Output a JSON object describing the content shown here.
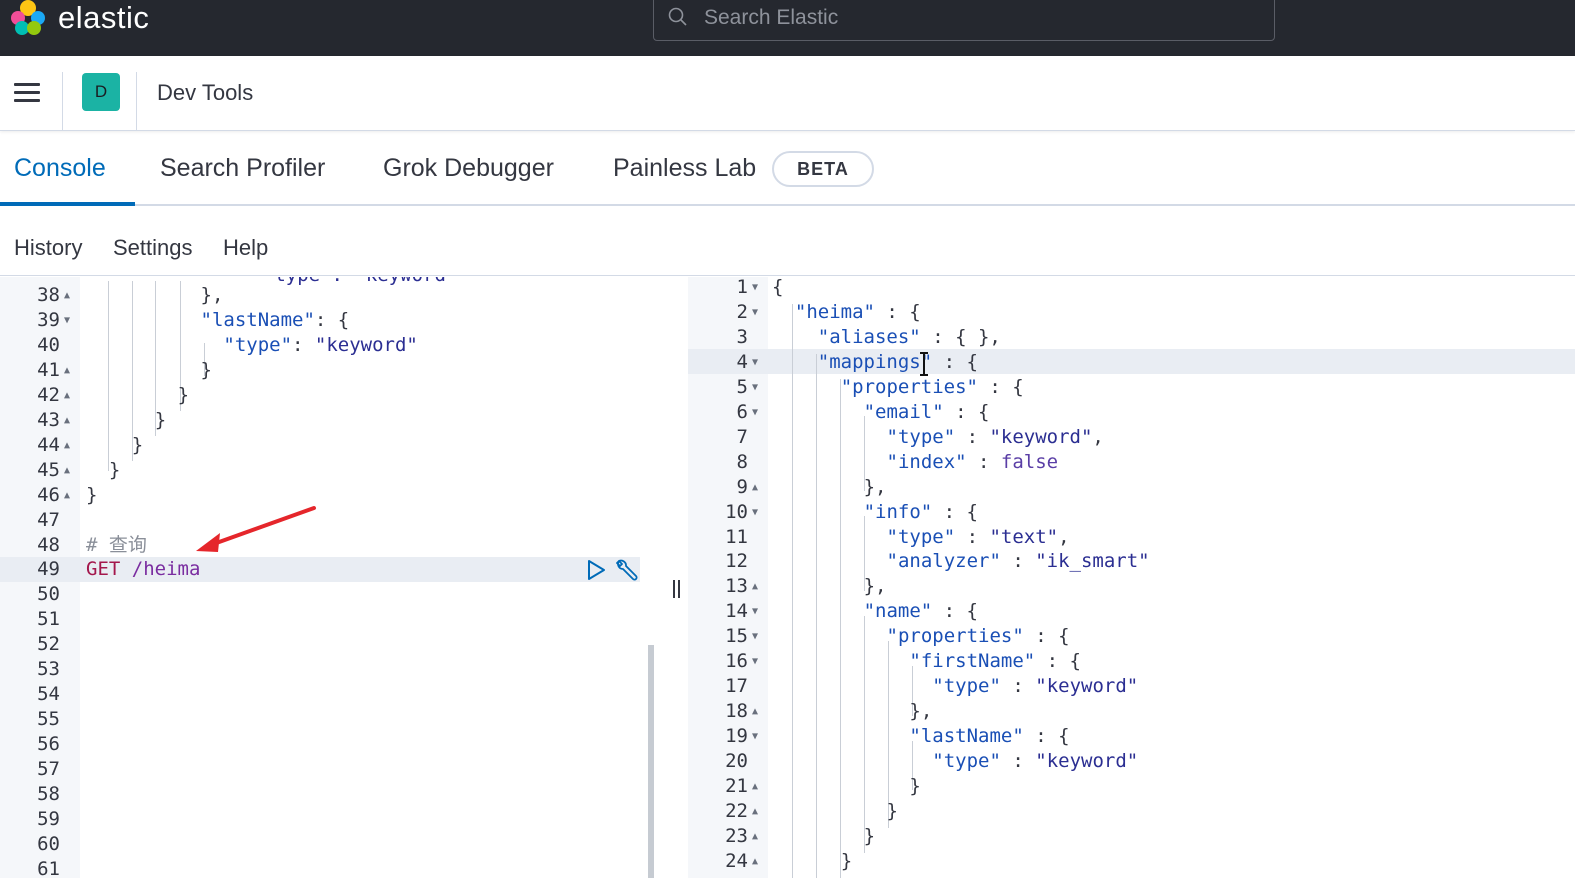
{
  "header": {
    "brand": "elastic",
    "search_placeholder": "Search Elastic"
  },
  "subheader": {
    "avatar_letter": "D",
    "title": "Dev Tools"
  },
  "tabs": [
    {
      "label": "Console",
      "active": true
    },
    {
      "label": "Search Profiler",
      "active": false
    },
    {
      "label": "Grok Debugger",
      "active": false
    },
    {
      "label": "Painless Lab",
      "active": false
    }
  ],
  "beta_badge": "BETA",
  "subnav": [
    "History",
    "Settings",
    "Help"
  ],
  "left_editor": {
    "partial_top_line": "  \"type\": \"keyword\"",
    "lines": [
      {
        "n": "38",
        "fold": "up",
        "text": "},"
      },
      {
        "n": "39",
        "fold": "down",
        "text": "\"lastName\": {"
      },
      {
        "n": "40",
        "fold": "",
        "text": "\"type\": \"keyword\""
      },
      {
        "n": "41",
        "fold": "up",
        "text": "}"
      },
      {
        "n": "42",
        "fold": "up",
        "text": "}"
      },
      {
        "n": "43",
        "fold": "up",
        "text": "}"
      },
      {
        "n": "44",
        "fold": "up",
        "text": "}"
      },
      {
        "n": "45",
        "fold": "up",
        "text": "}"
      },
      {
        "n": "46",
        "fold": "up",
        "text": "}"
      },
      {
        "n": "47",
        "fold": "",
        "text": ""
      },
      {
        "n": "48",
        "fold": "",
        "text": "# 查询"
      },
      {
        "n": "49",
        "fold": "",
        "text": "GET /heima"
      },
      {
        "n": "50",
        "fold": "",
        "text": ""
      },
      {
        "n": "51",
        "fold": "",
        "text": ""
      },
      {
        "n": "52",
        "fold": "",
        "text": ""
      },
      {
        "n": "53",
        "fold": "",
        "text": ""
      },
      {
        "n": "54",
        "fold": "",
        "text": ""
      },
      {
        "n": "55",
        "fold": "",
        "text": ""
      },
      {
        "n": "56",
        "fold": "",
        "text": ""
      },
      {
        "n": "57",
        "fold": "",
        "text": ""
      },
      {
        "n": "58",
        "fold": "",
        "text": ""
      },
      {
        "n": "59",
        "fold": "",
        "text": ""
      },
      {
        "n": "60",
        "fold": "",
        "text": ""
      },
      {
        "n": "61",
        "fold": "",
        "text": ""
      }
    ],
    "request_method": "GET",
    "request_path": "/heima",
    "comment": "# 查询"
  },
  "right_editor": {
    "lines": [
      {
        "n": "1",
        "fold": "down",
        "text": "{"
      },
      {
        "n": "2",
        "fold": "down",
        "text": "\"heima\" : {"
      },
      {
        "n": "3",
        "fold": "",
        "text": "\"aliases\" : { },"
      },
      {
        "n": "4",
        "fold": "down",
        "text": "\"mappings\" : {"
      },
      {
        "n": "5",
        "fold": "down",
        "text": "\"properties\" : {"
      },
      {
        "n": "6",
        "fold": "down",
        "text": "\"email\" : {"
      },
      {
        "n": "7",
        "fold": "",
        "text": "\"type\" : \"keyword\","
      },
      {
        "n": "8",
        "fold": "",
        "text": "\"index\" : false"
      },
      {
        "n": "9",
        "fold": "up",
        "text": "},"
      },
      {
        "n": "10",
        "fold": "down",
        "text": "\"info\" : {"
      },
      {
        "n": "11",
        "fold": "",
        "text": "\"type\" : \"text\","
      },
      {
        "n": "12",
        "fold": "",
        "text": "\"analyzer\" : \"ik_smart\""
      },
      {
        "n": "13",
        "fold": "up",
        "text": "},"
      },
      {
        "n": "14",
        "fold": "down",
        "text": "\"name\" : {"
      },
      {
        "n": "15",
        "fold": "down",
        "text": "\"properties\" : {"
      },
      {
        "n": "16",
        "fold": "down",
        "text": "\"firstName\" : {"
      },
      {
        "n": "17",
        "fold": "",
        "text": "\"type\" : \"keyword\""
      },
      {
        "n": "18",
        "fold": "up",
        "text": "},"
      },
      {
        "n": "19",
        "fold": "down",
        "text": "\"lastName\" : {"
      },
      {
        "n": "20",
        "fold": "",
        "text": "\"type\" : \"keyword\""
      },
      {
        "n": "21",
        "fold": "up",
        "text": "}"
      },
      {
        "n": "22",
        "fold": "up",
        "text": "}"
      },
      {
        "n": "23",
        "fold": "up",
        "text": "}"
      },
      {
        "n": "24",
        "fold": "up",
        "text": "}"
      }
    ]
  },
  "colors": {
    "accent": "#006bb8",
    "header_bg": "#25282f",
    "avatar_bg": "#1bb3a4",
    "annotation_arrow": "#e5262b"
  }
}
